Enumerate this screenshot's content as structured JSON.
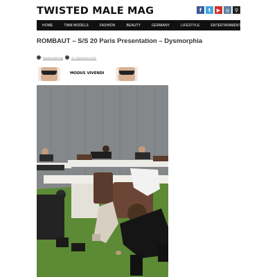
{
  "site": {
    "title": "TWISTED MALE MAG"
  },
  "social": [
    {
      "icon": "facebook-icon",
      "glyph": "f",
      "color": "#3b5998"
    },
    {
      "icon": "twitter-icon",
      "glyph": "t",
      "color": "#3fa9e0"
    },
    {
      "icon": "youtube-icon",
      "glyph": "▶",
      "color": "#d3322c"
    },
    {
      "icon": "instagram-icon",
      "glyph": "◎",
      "color": "#5b7fa3"
    },
    {
      "icon": "search-icon",
      "glyph": "⚲",
      "color": "#222222"
    }
  ],
  "nav": {
    "items": [
      "HOME",
      "TWM MODELS",
      "FASHION",
      "BEAUTY",
      "GERMANY",
      "LIFESTYLE",
      "ENTERTAINMENT"
    ]
  },
  "post": {
    "title": "ROMBAUT – S/S 20 Paris Presentation – Dysmorphia",
    "author": "twistedmalemag",
    "date": "24. September 2019"
  },
  "banner": {
    "brand": "MODUS VIVENDI"
  },
  "colors": {
    "nav_bg": "#111111",
    "floor": "#5c8a35",
    "wall": "#7d7f80"
  }
}
